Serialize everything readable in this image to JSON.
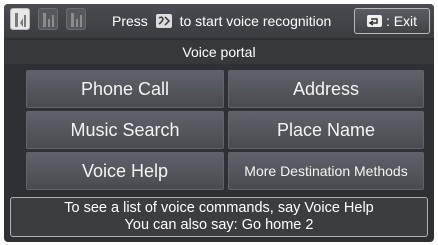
{
  "topbar": {
    "signal_icons": [
      "phone-signal-icon",
      "phone-signal-icon",
      "phone-signal-icon"
    ],
    "press_before": "Press",
    "talk_icon": "talk-button-icon",
    "press_after": "to start voice recognition",
    "exit_icon": "back-arrow-icon",
    "exit_label": ": Exit"
  },
  "title": "Voice portal",
  "buttons": {
    "phone_call": "Phone Call",
    "address": "Address",
    "music_search": "Music Search",
    "place_name": "Place Name",
    "voice_help": "Voice Help",
    "more_destination": "More Destination Methods"
  },
  "hint": {
    "line1": "To see a list of voice commands, say  Voice Help",
    "line2": "You can also say: Go home 2"
  }
}
